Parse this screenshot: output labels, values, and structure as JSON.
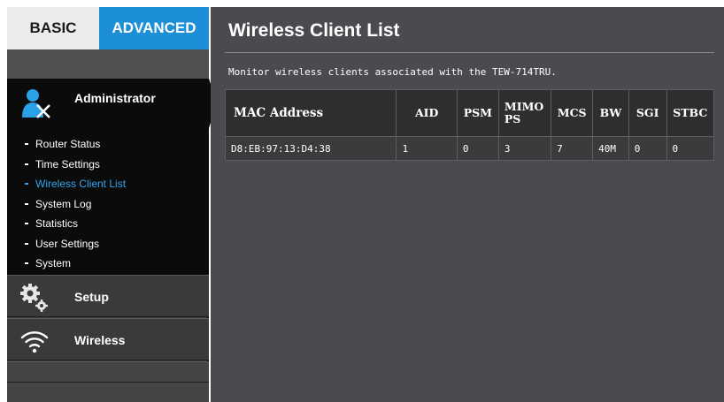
{
  "tabs": {
    "basic": "BASIC",
    "advanced": "ADVANCED"
  },
  "sidebar": {
    "admin_title": "Administrator",
    "items": [
      {
        "label": "Router Status",
        "active": false
      },
      {
        "label": "Time Settings",
        "active": false
      },
      {
        "label": "Wireless Client List",
        "active": true
      },
      {
        "label": "System Log",
        "active": false
      },
      {
        "label": "Statistics",
        "active": false
      },
      {
        "label": "User Settings",
        "active": false
      },
      {
        "label": "System",
        "active": false
      }
    ],
    "sections": [
      {
        "label": "Setup",
        "icon": "gears-icon"
      },
      {
        "label": "Wireless",
        "icon": "wifi-icon"
      }
    ]
  },
  "main": {
    "title": "Wireless Client List",
    "description": "Monitor wireless clients associated with the TEW-714TRU.",
    "table": {
      "headers": [
        "MAC Address",
        "AID",
        "PSM",
        "MIMO PS",
        "MCS",
        "BW",
        "SGI",
        "STBC"
      ],
      "rows": [
        [
          "D8:EB:97:13:D4:38",
          "1",
          "0",
          "3",
          "7",
          "40M",
          "0",
          "0"
        ]
      ]
    }
  },
  "colors": {
    "accent": "#1c8fd6",
    "active_link": "#2fa5f0",
    "background": "#4a4a4f"
  }
}
